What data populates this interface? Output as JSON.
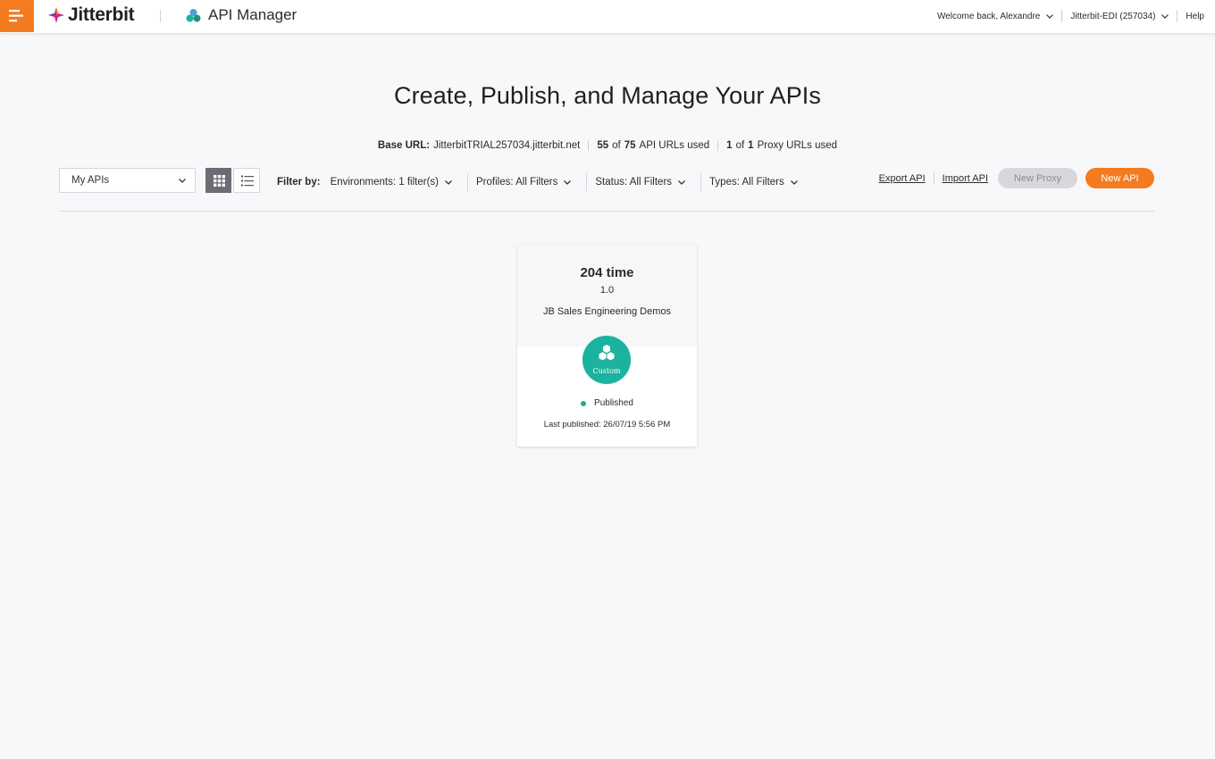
{
  "header": {
    "brand": "Jitterbit",
    "app_name": "API Manager",
    "welcome": "Welcome back, Alexandre",
    "org": "Jitterbit-EDI (257034)",
    "help": "Help"
  },
  "main": {
    "title": "Create, Publish, and Manage Your APIs",
    "base_url_label": "Base URL:",
    "base_url": "JitterbitTRIAL257034.jitterbit.net",
    "api_used": "55",
    "api_of": "of",
    "api_total": "75",
    "api_suffix": "API URLs used",
    "proxy_used": "1",
    "proxy_of": "of",
    "proxy_total": "1",
    "proxy_suffix": "Proxy URLs used"
  },
  "toolbar": {
    "scope_select": "My APIs",
    "filter_label": "Filter by:",
    "filters": [
      "Environments: 1 filter(s)",
      "Profiles: All Filters",
      "Status: All Filters",
      "Types: All Filters"
    ],
    "export": "Export API",
    "import": "Import API",
    "new_proxy": "New Proxy",
    "new_api": "New API"
  },
  "cards": [
    {
      "name": "204 time",
      "version": "1.0",
      "environment": "JB Sales Engineering Demos",
      "type": "Custom",
      "status": "Published",
      "last_published": "Last published: 26/07/19 5:56 PM"
    }
  ],
  "colors": {
    "accent": "#f47b20",
    "badge": "#1bb3a0",
    "status_published": "#1bb37a",
    "disabled_button": "#d7d7dc"
  },
  "icons": {
    "menu": "hamburger-icon",
    "brand": "jitterbit-logo-icon",
    "app": "api-manager-icon",
    "grid_view": "grid-view-icon",
    "list_view": "list-view-icon",
    "dropdown": "chevron-down-icon",
    "api_type": "custom-api-icon"
  }
}
